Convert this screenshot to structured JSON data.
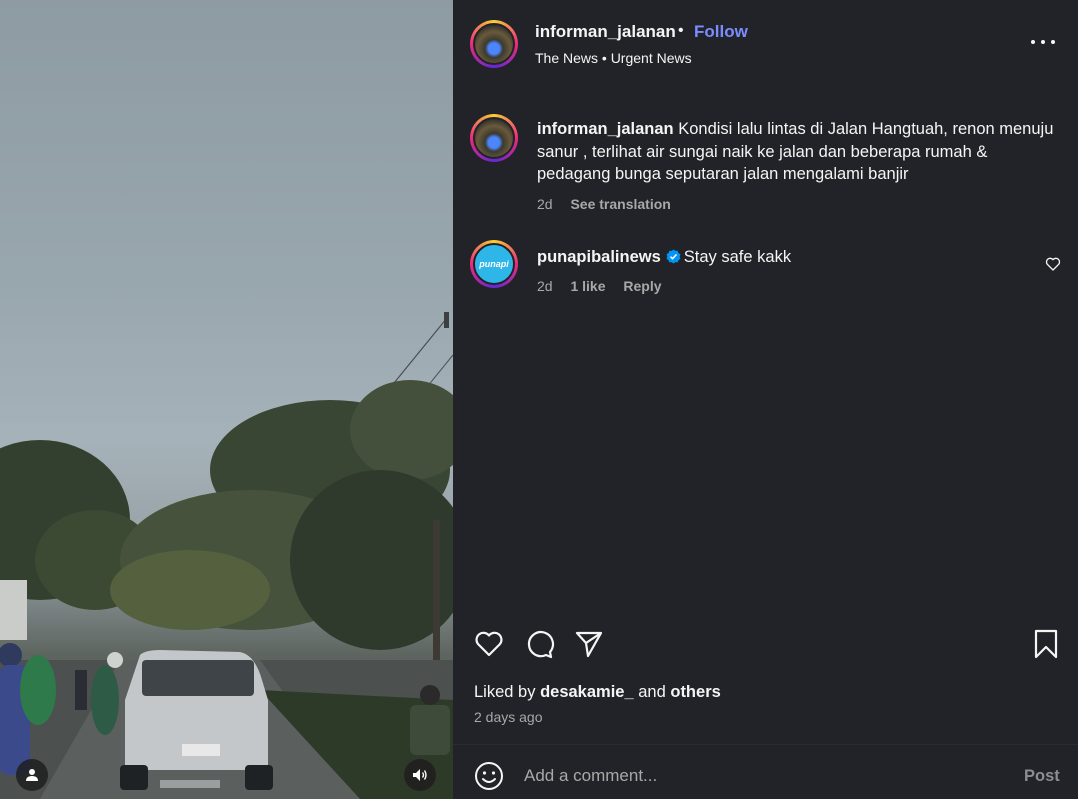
{
  "post": {
    "username": "informan_jalanan",
    "follow_label": "Follow",
    "separator": "•",
    "subtitle": "The News • Urgent News"
  },
  "caption": {
    "username": "informan_jalanan",
    "text": "Kondisi lalu lintas di Jalan Hangtuah, renon menuju sanur , terlihat air sungai naik ke jalan dan beberapa rumah & pedagang bunga seputaran jalan mengalami banjir",
    "age": "2d",
    "translate_label": "See translation"
  },
  "comments": [
    {
      "username": "punapibalinews",
      "avatar_text": "punapi",
      "text": "Stay safe kakk",
      "age": "2d",
      "likes": "1 like",
      "reply_label": "Reply"
    }
  ],
  "likes": {
    "prefix": "Liked by",
    "user": "desakamie_",
    "middle": "and",
    "others": "others"
  },
  "time_ago": "2 days ago",
  "composer": {
    "placeholder": "Add a comment...",
    "post_label": "Post"
  },
  "icons": {
    "more": "more-options-icon",
    "like": "heart-icon",
    "comment": "comment-icon",
    "share": "send-icon",
    "save": "bookmark-icon",
    "emoji": "emoji-icon",
    "tag": "user-tag-icon",
    "sound": "speaker-icon",
    "verified": "verified-badge-icon"
  },
  "colors": {
    "panel_bg": "#212328",
    "accent_link": "#7b8cff",
    "verified": "#0095f6",
    "muted_text": "#a8a8a8"
  }
}
